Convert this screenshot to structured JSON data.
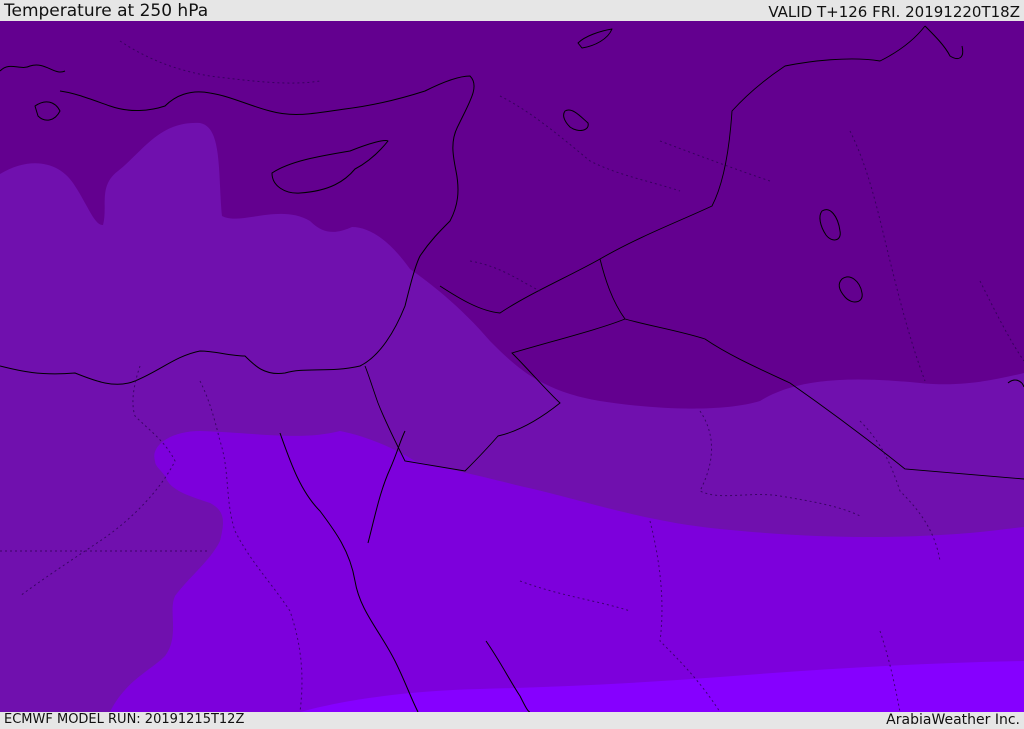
{
  "header": {
    "title": "Temperature at 250 hPa",
    "valid": "VALID T+126 FRI. 20191220T18Z"
  },
  "footer": {
    "model_run": "ECMWF MODEL RUN: 20191215T12Z",
    "credit": "ArabiaWeather Inc."
  },
  "colors": {
    "band_coldest": "#63008f",
    "band_cold": "#7010ae",
    "band_mid": "#7d00dc",
    "band_warm": "#8600ff",
    "frame": "#e6e6e6"
  }
}
